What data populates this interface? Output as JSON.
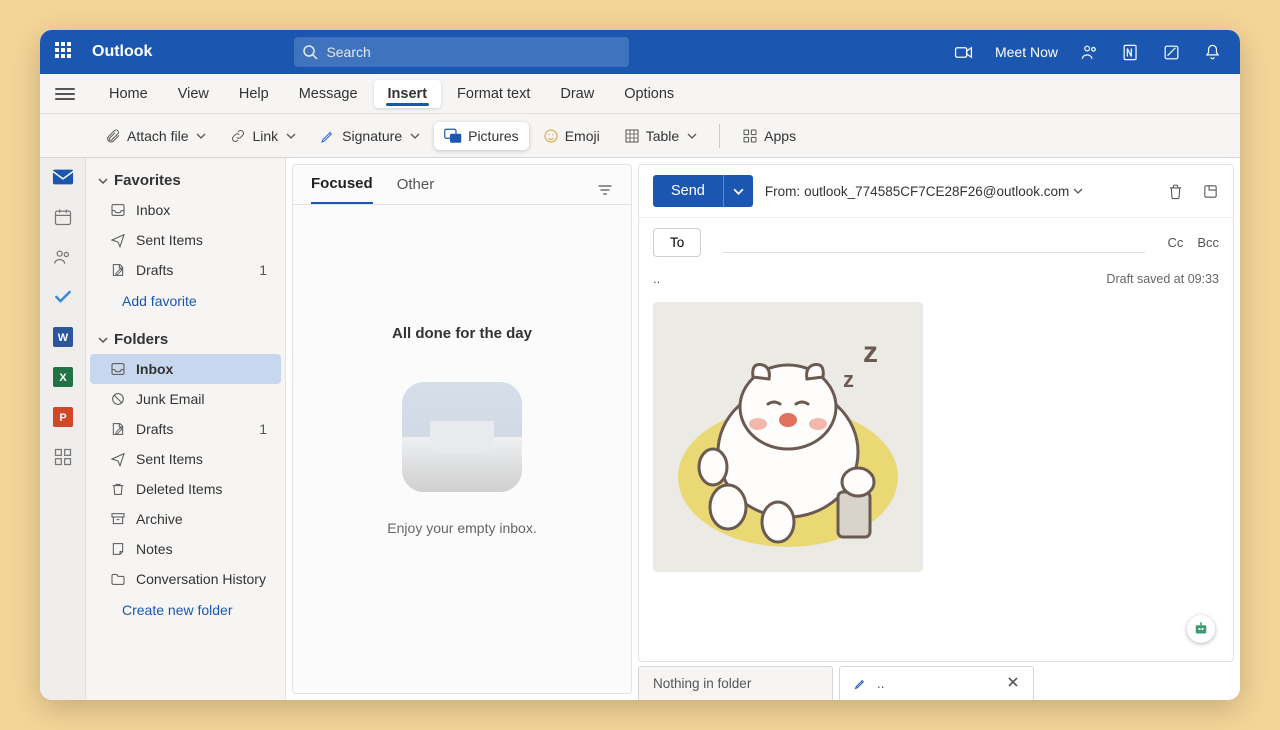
{
  "titlebar": {
    "brand": "Outlook",
    "search_placeholder": "Search",
    "meet_now": "Meet Now"
  },
  "menu": {
    "items": [
      "Home",
      "View",
      "Help",
      "Message",
      "Insert",
      "Format text",
      "Draw",
      "Options"
    ],
    "active": "Insert"
  },
  "ribbon": {
    "attach": "Attach file",
    "link": "Link",
    "signature": "Signature",
    "pictures": "Pictures",
    "emoji": "Emoji",
    "table": "Table",
    "apps": "Apps"
  },
  "nav": {
    "favorites_header": "Favorites",
    "favorites": [
      {
        "icon": "inbox",
        "label": "Inbox",
        "count": ""
      },
      {
        "icon": "send",
        "label": "Sent Items",
        "count": ""
      },
      {
        "icon": "draft",
        "label": "Drafts",
        "count": "1"
      }
    ],
    "add_favorite": "Add favorite",
    "folders_header": "Folders",
    "folders": [
      {
        "icon": "inbox",
        "label": "Inbox",
        "count": "",
        "sel": true
      },
      {
        "icon": "junk",
        "label": "Junk Email",
        "count": ""
      },
      {
        "icon": "draft",
        "label": "Drafts",
        "count": "1"
      },
      {
        "icon": "send",
        "label": "Sent Items",
        "count": ""
      },
      {
        "icon": "trash",
        "label": "Deleted Items",
        "count": ""
      },
      {
        "icon": "archive",
        "label": "Archive",
        "count": ""
      },
      {
        "icon": "note",
        "label": "Notes",
        "count": ""
      },
      {
        "icon": "folder",
        "label": "Conversation History",
        "count": ""
      }
    ],
    "create_folder": "Create new folder"
  },
  "list": {
    "focused": "Focused",
    "other": "Other",
    "empty_title": "All done for the day",
    "empty_sub": "Enjoy your empty inbox."
  },
  "compose": {
    "send": "Send",
    "from_label": "From:",
    "from_value": "outlook_774585CF7CE28F26@outlook.com",
    "to": "To",
    "cc": "Cc",
    "bcc": "Bcc",
    "subject_dots": "..",
    "draft_saved": "Draft saved at 09:33"
  },
  "bottom_tabs": {
    "first": "Nothing in folder",
    "second": ".."
  }
}
